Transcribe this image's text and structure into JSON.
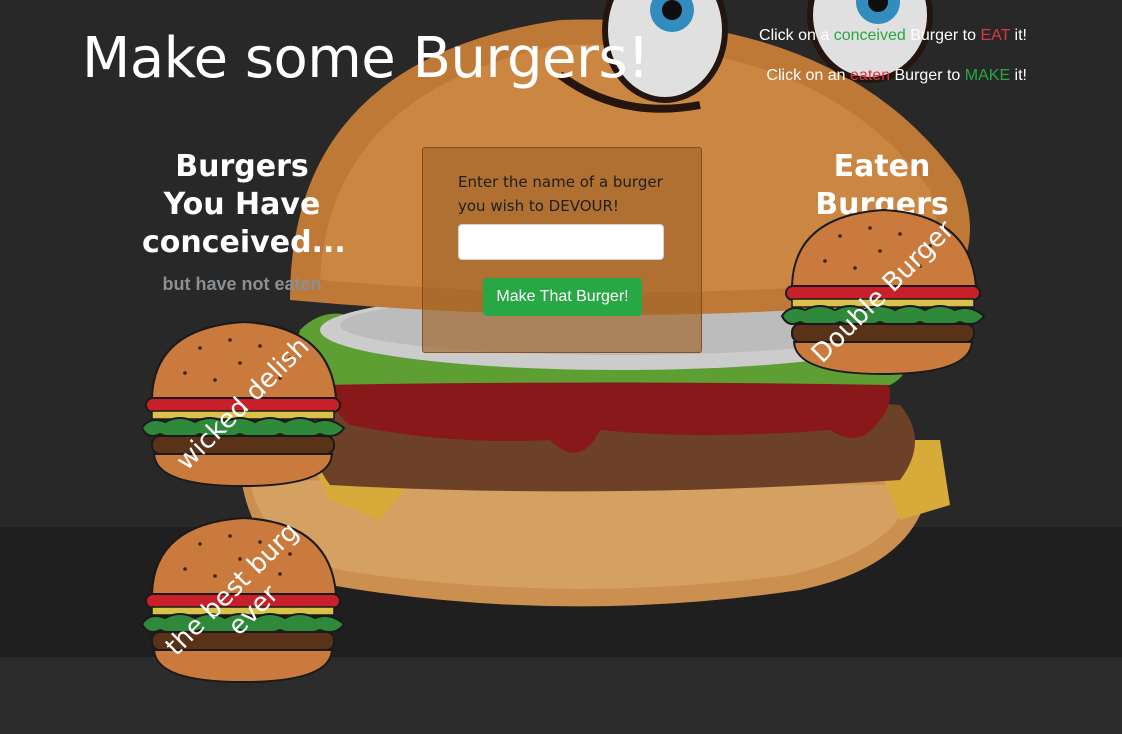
{
  "header": {
    "title": "Make some Burgers!",
    "instruction_1": {
      "prefix": "Click on a ",
      "keyword": "conceived",
      "middle": " Burger to ",
      "action": "EAT",
      "suffix": " it!"
    },
    "instruction_2": {
      "prefix": "Click on an ",
      "keyword": "eaten",
      "middle": " Burger to ",
      "action": "MAKE",
      "suffix": " it!"
    }
  },
  "left_column": {
    "title": "Burgers You Have conceived...",
    "subtitle": "but have not eaten",
    "burgers": [
      {
        "name": "wicked delish"
      },
      {
        "name": "the best burg ever"
      }
    ]
  },
  "form": {
    "label": "Enter the name of a burger you wish to DEVOUR!",
    "input_value": "",
    "input_placeholder": "",
    "button_label": "Make That Burger!"
  },
  "right_column": {
    "title": "Eaten Burgers",
    "burgers": [
      {
        "name": "Double Burger"
      }
    ]
  },
  "colors": {
    "accent_green": "#28a745",
    "accent_red": "#dc3545",
    "subtitle_gray": "#8a8f94",
    "card_bg": "#a0642899"
  },
  "icons": {
    "burger_icon": "burger-icon",
    "background": "cartoon-burger-background"
  }
}
